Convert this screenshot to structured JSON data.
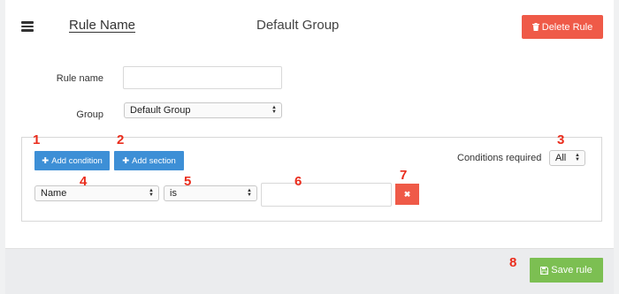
{
  "header": {
    "menu_icon": "hamburger-icon",
    "rule_title": "Rule Name",
    "group_title": "Default Group",
    "delete_label": "Delete Rule",
    "delete_icon": "trash-icon"
  },
  "form": {
    "rule_name_label": "Rule name",
    "rule_name_value": "",
    "group_label": "Group",
    "group_value": "Default Group"
  },
  "conditions": {
    "add_condition_label": "Add condition",
    "add_section_label": "Add section",
    "plus_icon": "plus-icon",
    "required_label": "Conditions required",
    "required_value": "All",
    "rows": [
      {
        "field": "Name",
        "operator": "is",
        "value": "",
        "remove_icon": "close-icon"
      }
    ]
  },
  "footer": {
    "save_label": "Save rule",
    "save_icon": "floppy-disk-icon"
  },
  "annotations": [
    "1",
    "2",
    "3",
    "4",
    "5",
    "6",
    "7",
    "8"
  ],
  "colors": {
    "delete": "#ef5a48",
    "primary": "#3d8fd6",
    "save": "#7cbf52",
    "annotation": "#ea2c1c"
  }
}
